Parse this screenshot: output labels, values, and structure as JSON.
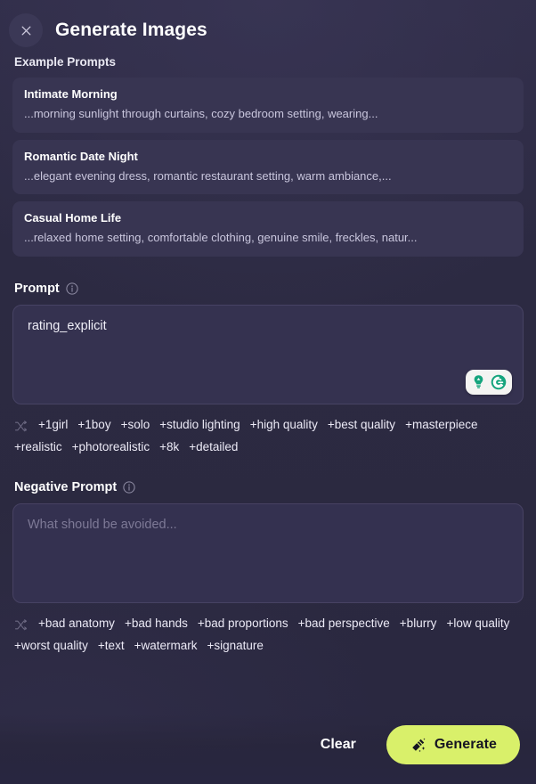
{
  "header": {
    "title": "Generate Images",
    "close_icon": "close-icon"
  },
  "examples": {
    "label": "Example Prompts",
    "items": [
      {
        "title": "Intimate Morning",
        "snippet": "...morning sunlight through curtains, cozy bedroom setting, wearing..."
      },
      {
        "title": "Romantic Date Night",
        "snippet": "...elegant evening dress, romantic restaurant setting, warm ambiance,..."
      },
      {
        "title": "Casual Home Life",
        "snippet": "...relaxed home setting, comfortable clothing, genuine smile, freckles, natur..."
      }
    ]
  },
  "prompt": {
    "label": "Prompt",
    "info_icon": "info-icon",
    "value": "rating_explicit",
    "placeholder": "",
    "grammarly": {
      "bulb_icon": "lightbulb-icon",
      "logo_icon": "grammarly-logo-icon"
    },
    "shuffle_icon": "shuffle-icon",
    "tags": [
      "+1girl",
      "+1boy",
      "+solo",
      "+studio lighting",
      "+high quality",
      "+best quality",
      "+masterpiece",
      "+realistic",
      "+photorealistic",
      "+8k",
      "+detailed"
    ]
  },
  "negative_prompt": {
    "label": "Negative Prompt",
    "info_icon": "info-icon",
    "value": "",
    "placeholder": "What should be avoided...",
    "shuffle_icon": "shuffle-icon",
    "tags": [
      "+bad anatomy",
      "+bad hands",
      "+bad proportions",
      "+bad perspective",
      "+blurry",
      "+low quality",
      "+worst quality",
      "+text",
      "+watermark",
      "+signature"
    ]
  },
  "footer": {
    "clear_label": "Clear",
    "generate_label": "Generate",
    "generate_icon": "magic-wand-icon"
  },
  "colors": {
    "page_background": "#2c2a42",
    "card_background": "#383552",
    "input_background": "#353250",
    "input_border": "#474364",
    "accent_generate": "#d9f06a",
    "grammarly_green": "#15a47d",
    "text_primary": "#ffffff",
    "text_secondary": "#c9c6dd",
    "placeholder": "#7d7996"
  }
}
